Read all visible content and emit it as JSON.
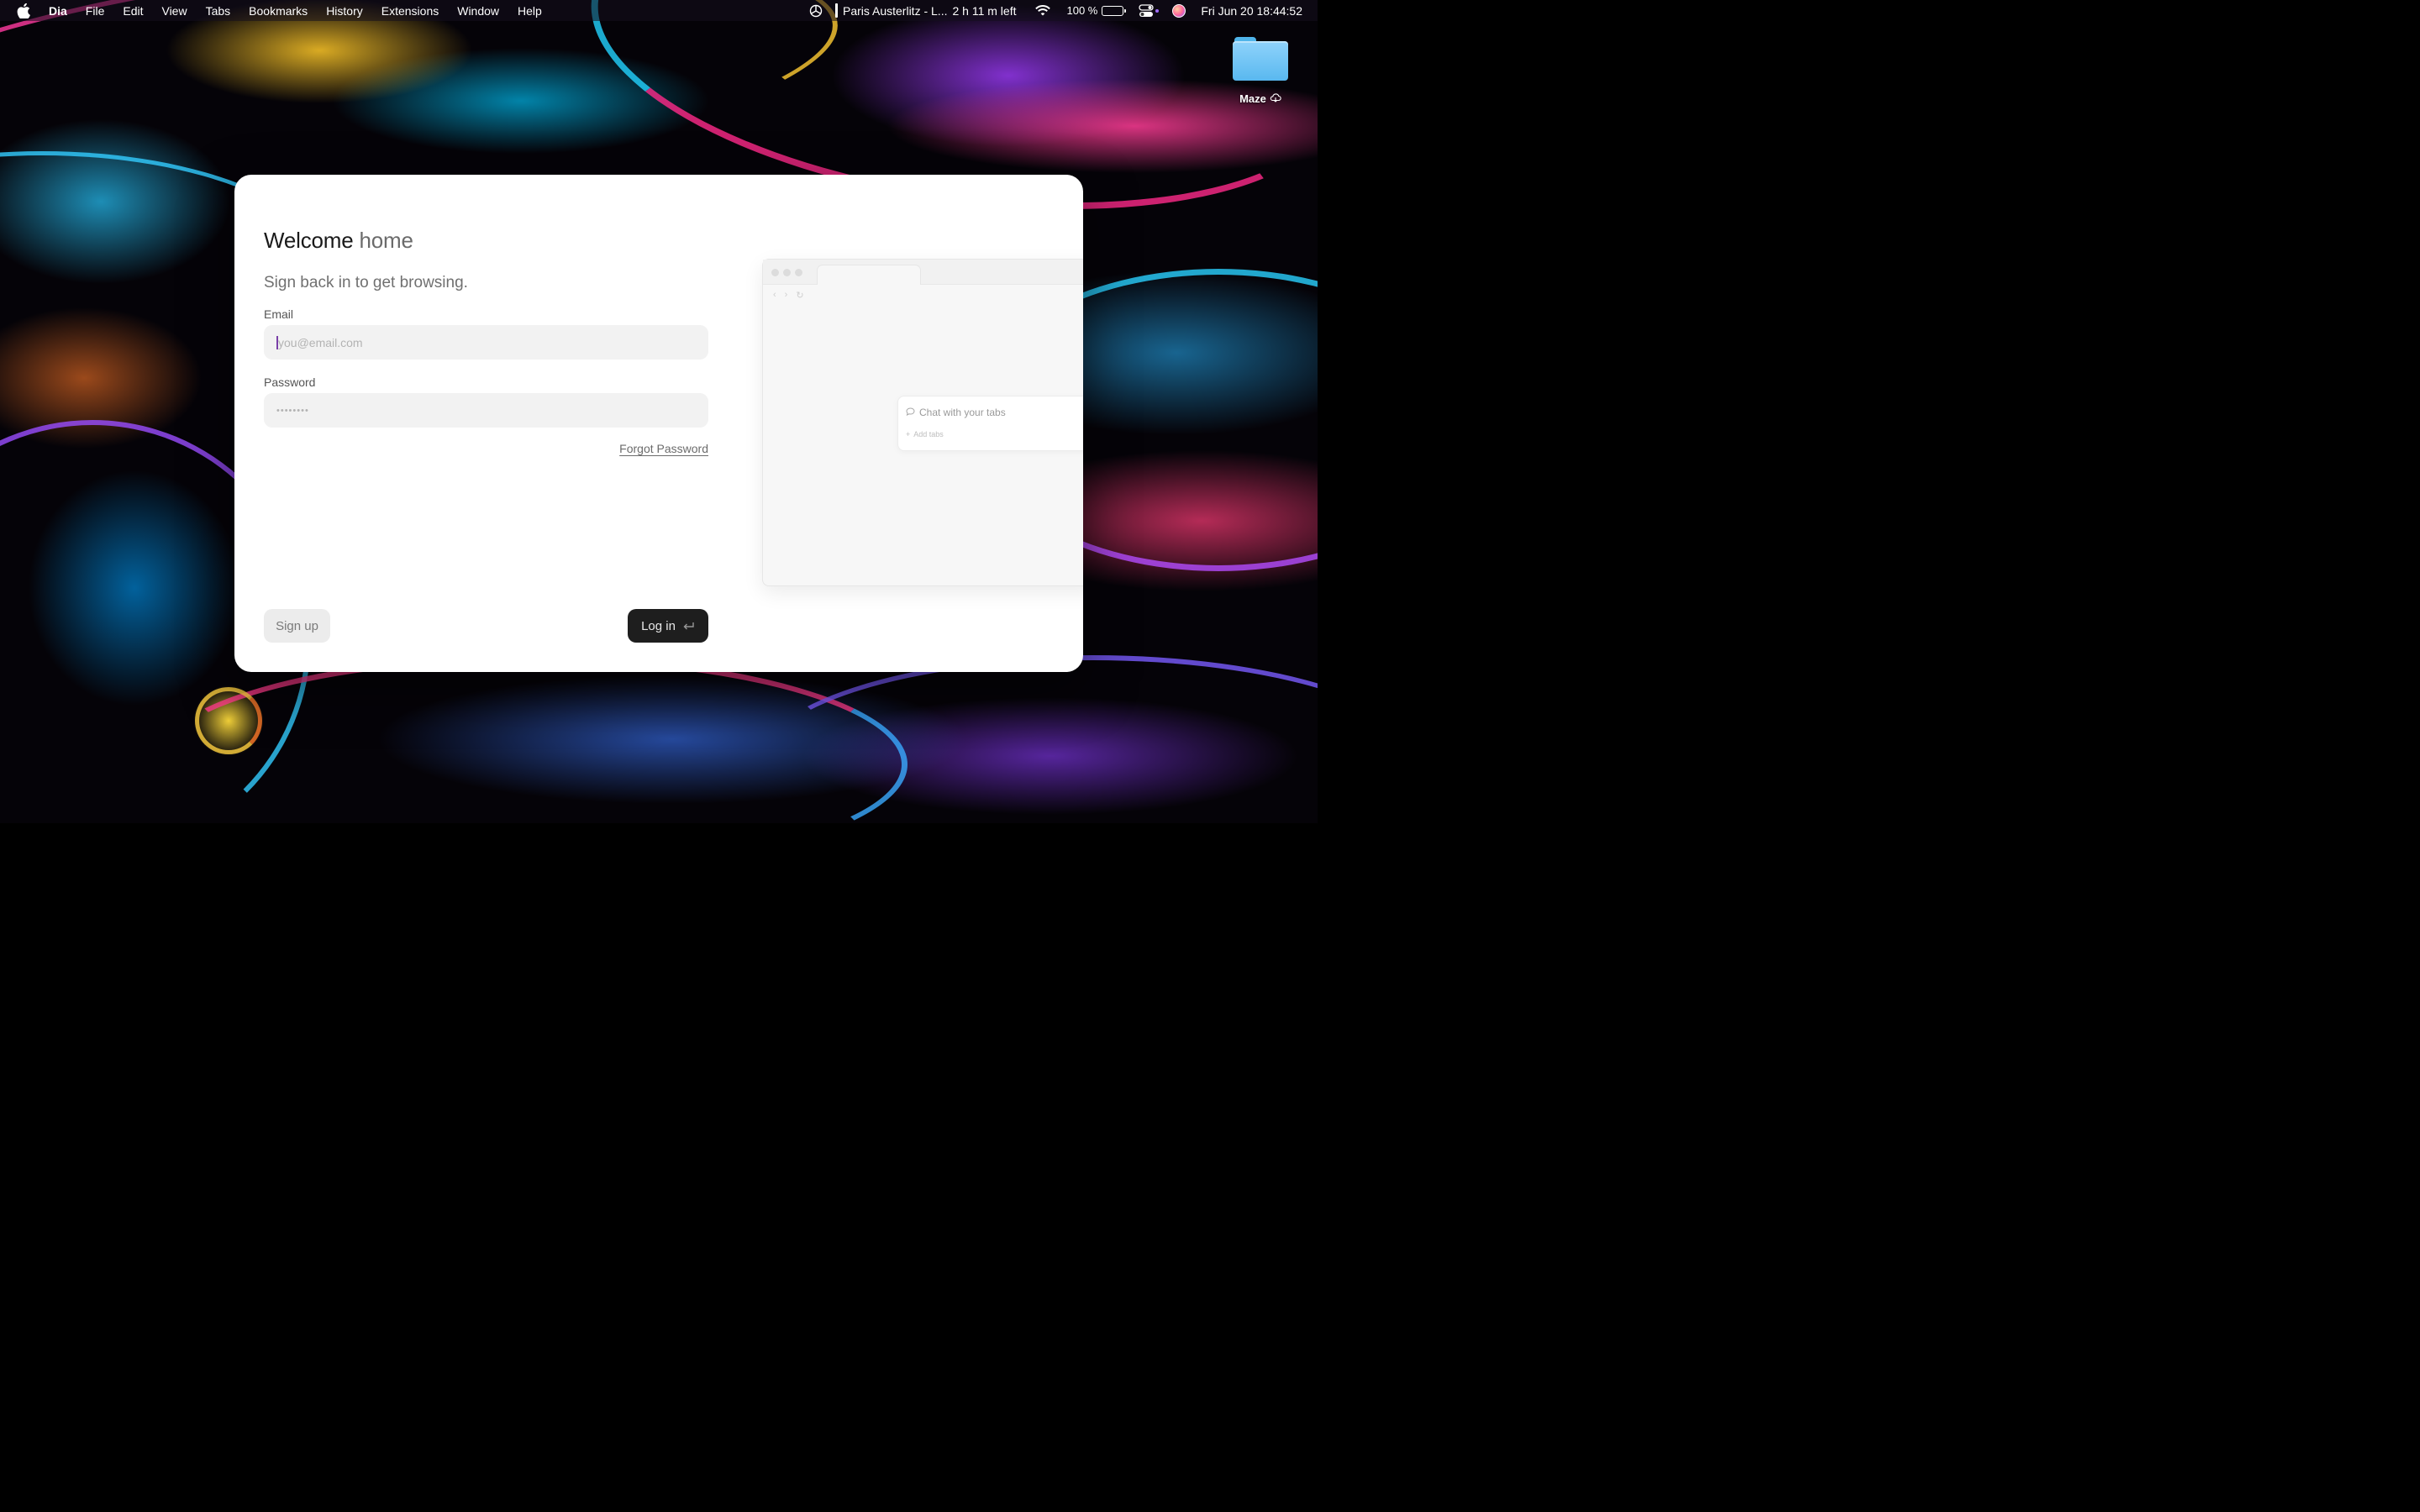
{
  "menubar": {
    "app_name": "Dia",
    "items": [
      "File",
      "Edit",
      "View",
      "Tabs",
      "Bookmarks",
      "History",
      "Extensions",
      "Window",
      "Help"
    ],
    "now_playing": "Paris Austerlitz - L...",
    "time_left": "2 h 11 m left",
    "battery_percent": "100 %",
    "datetime": "Fri Jun 20   18:44:52"
  },
  "desktop": {
    "folder_label": "Maze"
  },
  "login": {
    "title_strong": "Welcome",
    "title_muted": "home",
    "subtitle": "Sign back in to get browsing.",
    "email_label": "Email",
    "email_placeholder": "you@email.com",
    "password_label": "Password",
    "password_masked": "••••••••",
    "forgot_password": "Forgot Password",
    "signup_button": "Sign up",
    "login_button": "Log in"
  },
  "preview": {
    "chat_placeholder": "Chat with your tabs",
    "add_tabs": "Add tabs"
  }
}
